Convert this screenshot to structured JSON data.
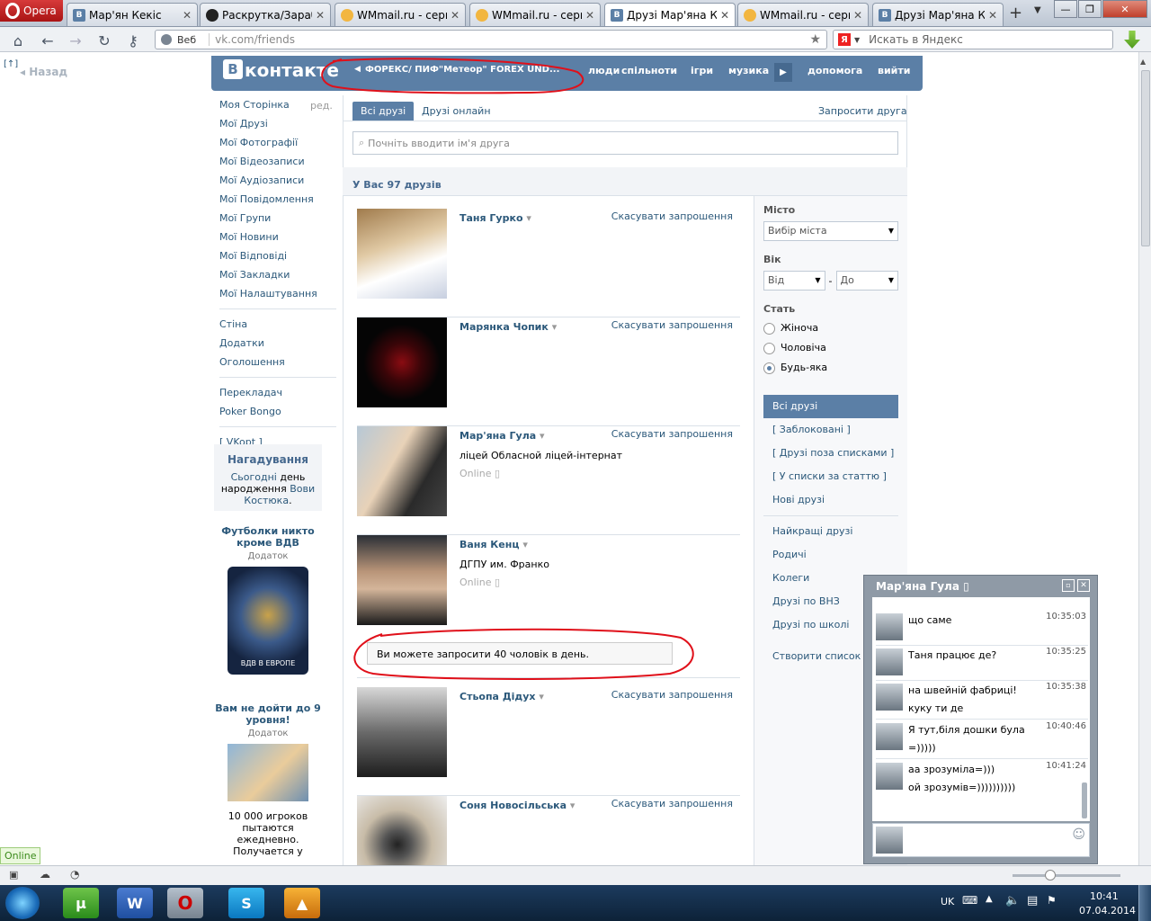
{
  "browser": {
    "menu_label": "Opera",
    "tabs": [
      {
        "title": "Мар'ян Кекіс",
        "icon": "vk",
        "fav_text": "B"
      },
      {
        "title": "Раскрутка/Зараб...",
        "icon": "site",
        "fav_text": ""
      },
      {
        "title": "WMmail.ru - серв...",
        "icon": "wmmail",
        "fav_text": ""
      },
      {
        "title": "WMmail.ru - серв...",
        "icon": "wmmail",
        "fav_text": ""
      },
      {
        "title": "Друзі Мар'яна Ке...",
        "icon": "vk",
        "fav_text": "B"
      },
      {
        "title": "WMmail.ru - серв...",
        "icon": "wmmail",
        "fav_text": ""
      },
      {
        "title": "Друзі Мар'яна Ке...",
        "icon": "vk",
        "fav_text": "B"
      }
    ],
    "address_prefix": "Веб",
    "url": "vk.com/friends",
    "search_placeholder": "Искать в Яндекс",
    "back_label": "Назад",
    "status_online": "Online"
  },
  "vk": {
    "logo_text": "контакте",
    "logo_letter": "B",
    "app_link": "ФОРЕКС/ ПИФ\"Метеор\" FOREX UND...",
    "top_menu": [
      "люди",
      "спільноти",
      "ігри",
      "музика",
      "допомога",
      "вийти"
    ],
    "left_menu": {
      "edit_label": "ред.",
      "main": [
        "Моя Сторінка",
        "Мої Друзі",
        "Мої Фотографії",
        "Мої Відеозаписи",
        "Мої Аудіозаписи",
        "Мої Повідомлення",
        "Мої Групи",
        "Мої Новини",
        "Мої Відповіді",
        "Мої Закладки",
        "Мої Налаштування"
      ],
      "secondary": [
        "Стіна",
        "Додатки",
        "Оголошення"
      ],
      "tertiary": [
        "Перекладач",
        "Poker Bongo"
      ],
      "vkopt": "[ VKopt ]"
    },
    "reminder": {
      "title": "Нагадування",
      "line1": "Сьогодні",
      "line2": "день народження",
      "name1": "Вови",
      "name2": "Костюка"
    },
    "ads": [
      {
        "title": "Футболки никто кроме ВДВ",
        "sub": "Додаток",
        "img_text": "ВДВ В ЕВРОПЕ"
      },
      {
        "title": "Вам не дойти до 9 уровня!",
        "sub": "Додаток",
        "body": "10 000 игроков пытаются ежедневно. Получается у"
      }
    ],
    "tabs": {
      "all": "Всі друзі",
      "online": "Друзі онлайн",
      "invite": "Запросити друга"
    },
    "search_placeholder": "Почніть вводити ім'я друга",
    "friends_count": "У Вас 97 друзів",
    "cancel_label": "Скасувати запрошення",
    "friends": [
      {
        "name": "Таня Гурко",
        "sub": "",
        "online": "",
        "photo": "girl"
      },
      {
        "name": "Марянка Чопик",
        "sub": "",
        "online": "",
        "photo": "trident"
      },
      {
        "name": "Мар'яна Гула",
        "sub": "ліцей Обласной ліцей-інтернат",
        "online": "Online",
        "photo": "couple"
      },
      {
        "name": "Ваня Кенц",
        "sub": "ДГПУ им. Франко",
        "online": "Online",
        "photo": "man"
      },
      {
        "name": "Стьопа Дідух",
        "sub": "",
        "online": "",
        "photo": "man2"
      },
      {
        "name": "Соня Новосільська",
        "sub": "",
        "online": "",
        "photo": "camera"
      }
    ],
    "limit_notice": "Ви можете запросити 40 чоловік в день.",
    "filters": {
      "city_label": "Місто",
      "city_value": "Вибір міста",
      "age_label": "Вік",
      "age_from": "Від",
      "age_to": "До",
      "age_dash": "-",
      "sex_label": "Стать",
      "sex_options": [
        "Жіноча",
        "Чоловіча",
        "Будь-яка"
      ],
      "sex_selected": 2
    },
    "lists": {
      "group1": [
        "Всі друзі",
        "[ Заблоковані ]",
        "[ Друзі поза списками ]",
        "[ У списки за статтю ]",
        "Нові друзі"
      ],
      "group2": [
        "Найкращі друзі",
        "Родичі",
        "Колеги",
        "Друзі по ВНЗ",
        "Друзі по школі"
      ],
      "create": "Створити список"
    }
  },
  "chat": {
    "title": "Мар'яна Гула",
    "messages": [
      {
        "text": "що саме",
        "text2": "",
        "time": "10:35:03"
      },
      {
        "text": "Таня працює де?",
        "text2": "",
        "time": "10:35:25"
      },
      {
        "text": "на швейній фабриці!",
        "text2": "куку ти де",
        "time": "10:35:38"
      },
      {
        "text": "Я тут,біля дошки була",
        "text2": "=)))))",
        "time": "10:40:46"
      },
      {
        "text": "аа зрозуміла=)))",
        "text2": "ой зрозумів=))))))))))",
        "time": "10:41:24"
      }
    ]
  },
  "taskbar": {
    "lang": "UK",
    "time": "10:41",
    "date": "07.04.2014"
  },
  "colors": {
    "vk_blue": "#5b7fa6",
    "link": "#2b587a",
    "annotation_red": "#e0101a"
  }
}
